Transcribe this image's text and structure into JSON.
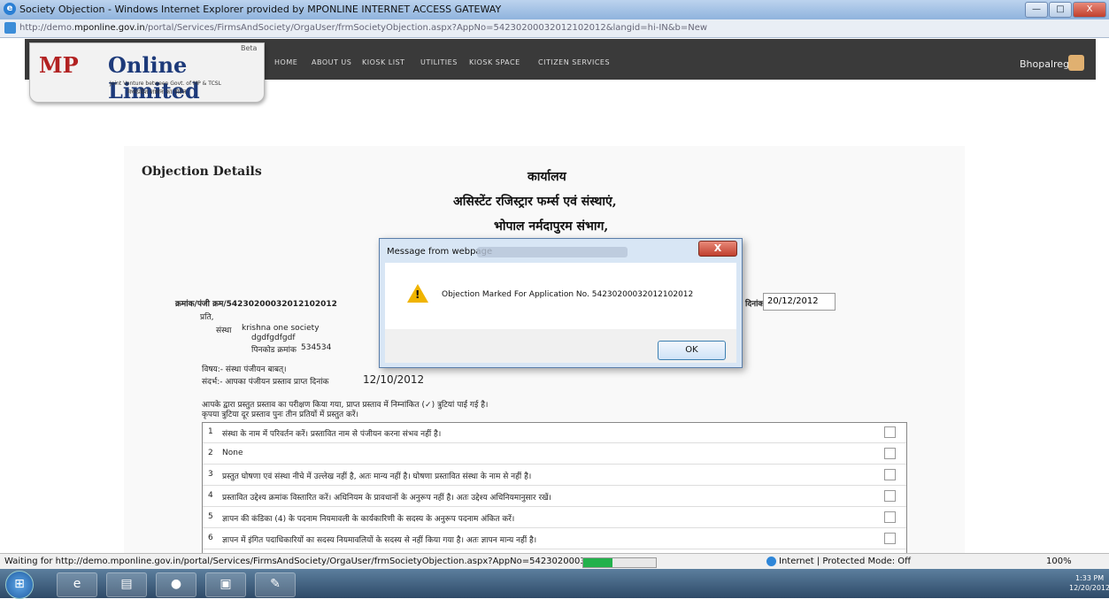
{
  "window": {
    "title": "Society Objection - Windows Internet Explorer provided by MPONLINE INTERNET ACCESS GATEWAY",
    "url_prefix": "http://demo.",
    "url_host": "mponline.gov.in",
    "url_rest": "/portal/Services/FirmsAndSociety/OrgaUser/frmSocietyObjection.aspx?AppNo=54230200032012102012&langid=hi-IN&b=New",
    "min_label": "—",
    "max_label": "□",
    "close_label": "X"
  },
  "site": {
    "logo_mp": "MP",
    "logo_online": "Online Limited",
    "logo_beta": "Beta",
    "logo_sub1": "Joint Venture between Govt. of MP & TCSL",
    "logo_sub2": "मध्यप्रदेश शासन का पोर्टल",
    "nav": [
      "HOME",
      "ABOUT US",
      "KIOSK LIST",
      "UTILITIES",
      "KIOSK SPACE",
      "CITIZEN SERVICES"
    ],
    "user": "Bhopalreg"
  },
  "page": {
    "section_title": "Objection Details",
    "office": "कार्यालय",
    "office_line2": "असिस्टेंट रजिस्ट्रार फर्म्स एवं संस्थाएं,",
    "office_line3": "भोपाल नर्मदापुरम संभाग,",
    "ref_label": "क्रमांक/पंजी क्रम/54230200032012102012",
    "date_label": "दिनांक",
    "date_value": "20/12/2012",
    "prati": "प्रति,",
    "addr_prefix": "संस्था",
    "addr_name": "krishna one society",
    "addr_line": "dgdfgdfgdf",
    "addr_pin_label": "पिनकोड क्रमांक",
    "addr_pin": "534534",
    "subject": "विषय:- संस्था पंजीयन बाबत्।",
    "reference": "संदर्भ:- आपका पंजीयन प्रस्ताव प्राप्त दिनांक",
    "ref_date": "12/10/2012",
    "para1": "आपके द्वारा प्रस्तुत प्रस्ताव का परीक्षण किया गया, प्राप्त प्रस्ताव में निम्नांकित (✓) त्रुटियां पाई गई है।",
    "para2": "कृपया त्रुटिया दूर प्रस्ताव पुनः तीन प्रतियों में प्रस्तुत करें।",
    "objections": [
      {
        "n": "1",
        "text": "संस्था के नाम में परिवर्तन करें। प्रस्तावित नाम से पंजीयन करना संभव नहीं है।"
      },
      {
        "n": "2",
        "text": "None"
      },
      {
        "n": "3",
        "text": "प्रस्तुत घोषणा एवं संस्था नीचे में उल्लेख नहीं है, अतः मान्य नहीं है। घोषणा प्रस्तावित संस्था के नाम से नहीं है।"
      },
      {
        "n": "4",
        "text": "प्रस्तावित उद्देश्य क्रमांक विस्तारित करें। अधिनियम के प्रावधानों के अनुरूप नहीं है। अतः उद्देश्य अधिनियमानुसार रखें।"
      },
      {
        "n": "5",
        "text": "ज्ञापन की कंडिका (4) के पदनाम नियमावली के कार्यकारिणी के सदस्य के अनुरूप पदनाम अंकित करें।"
      },
      {
        "n": "6",
        "text": "ज्ञापन में इंगित पदाधिकारियों का सदस्य नियमावलियों के सदस्य से नहीं किया गया है। अतः ज्ञापन मान्य नहीं है।"
      }
    ]
  },
  "dialog": {
    "caption": "Message from webpage",
    "message": "Objection Marked For Application No. 54230200032012102012",
    "ok_label": "OK",
    "close_label": "X"
  },
  "status": {
    "text": "Waiting for http://demo.mponline.gov.in/portal/Services/FirmsAndSociety/OrgaUser/frmSocietyObjection.aspx?AppNo=54230200032",
    "progress": 0.4,
    "zone": "Internet | Protected Mode: Off",
    "zoom": "100%"
  },
  "taskbar": {
    "time": "1:33 PM",
    "date": "12/20/2012"
  },
  "colors": {
    "nav_bg": "#3a3a3a",
    "logo_red": "#b22222",
    "logo_blue": "#1d3a7a",
    "progress": "#22b14c"
  }
}
